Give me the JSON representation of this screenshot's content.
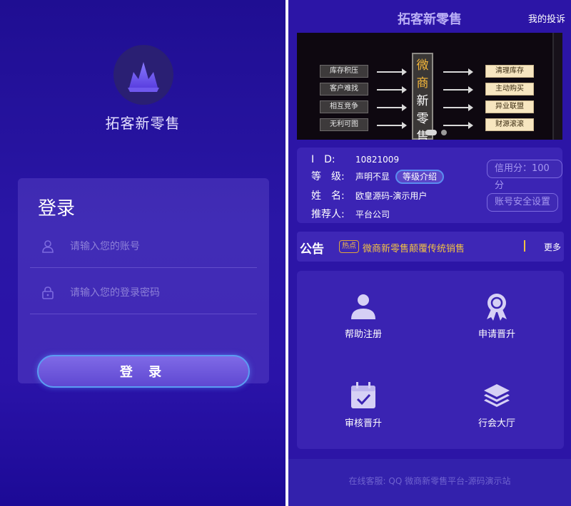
{
  "login": {
    "app_name": "拓客新零售",
    "title": "登录",
    "account_placeholder": "请输入您的账号",
    "password_placeholder": "请输入您的登录密码",
    "button_label": "登 录",
    "icons": [
      "crown-logo-icon",
      "user-icon",
      "lock-icon"
    ]
  },
  "home": {
    "title": "拓客新零售",
    "complaint_link": "我的投诉",
    "banner": {
      "left_items": [
        "库存积压",
        "客户难找",
        "相互竞争",
        "无利可图"
      ],
      "center_chars": [
        "微",
        "商",
        "新",
        "零",
        "售"
      ],
      "right_items": [
        "清理库存",
        "主动购买",
        "异业联盟",
        "财源滚滚"
      ],
      "slide_index": 1,
      "slide_count": 2
    },
    "user": {
      "id_label": "I　D:",
      "id_value": "10821009",
      "level_label": "等　级:",
      "level_value": "声明不显",
      "level_intro_button": "等级介绍",
      "name_label": "姓　名:",
      "name_value": "欧皇源码-演示用户",
      "referrer_label": "推荐人:",
      "referrer_value": "平台公司",
      "credit_button": "信用分：100分",
      "security_button": "账号安全设置"
    },
    "notice": {
      "label": "公告",
      "badge": "热点",
      "text": "微商新零售颠覆传统销售",
      "more": "更多"
    },
    "menu": [
      {
        "label": "帮助注册",
        "icon": "person-icon"
      },
      {
        "label": "申请晋升",
        "icon": "award-ribbon-icon"
      },
      {
        "label": "审核晋升",
        "icon": "calendar-check-icon"
      },
      {
        "label": "行会大厅",
        "icon": "layers-icon"
      }
    ],
    "footer_text": "在线客服:   QQ 微商新零售平台-源码演示站"
  },
  "colors": {
    "login_bg": "#2a16a6",
    "home_bg": "#2c15a6",
    "card_bg": "#3b24b4",
    "accent": "#7f6ae6",
    "notice_text": "#f2c244"
  }
}
